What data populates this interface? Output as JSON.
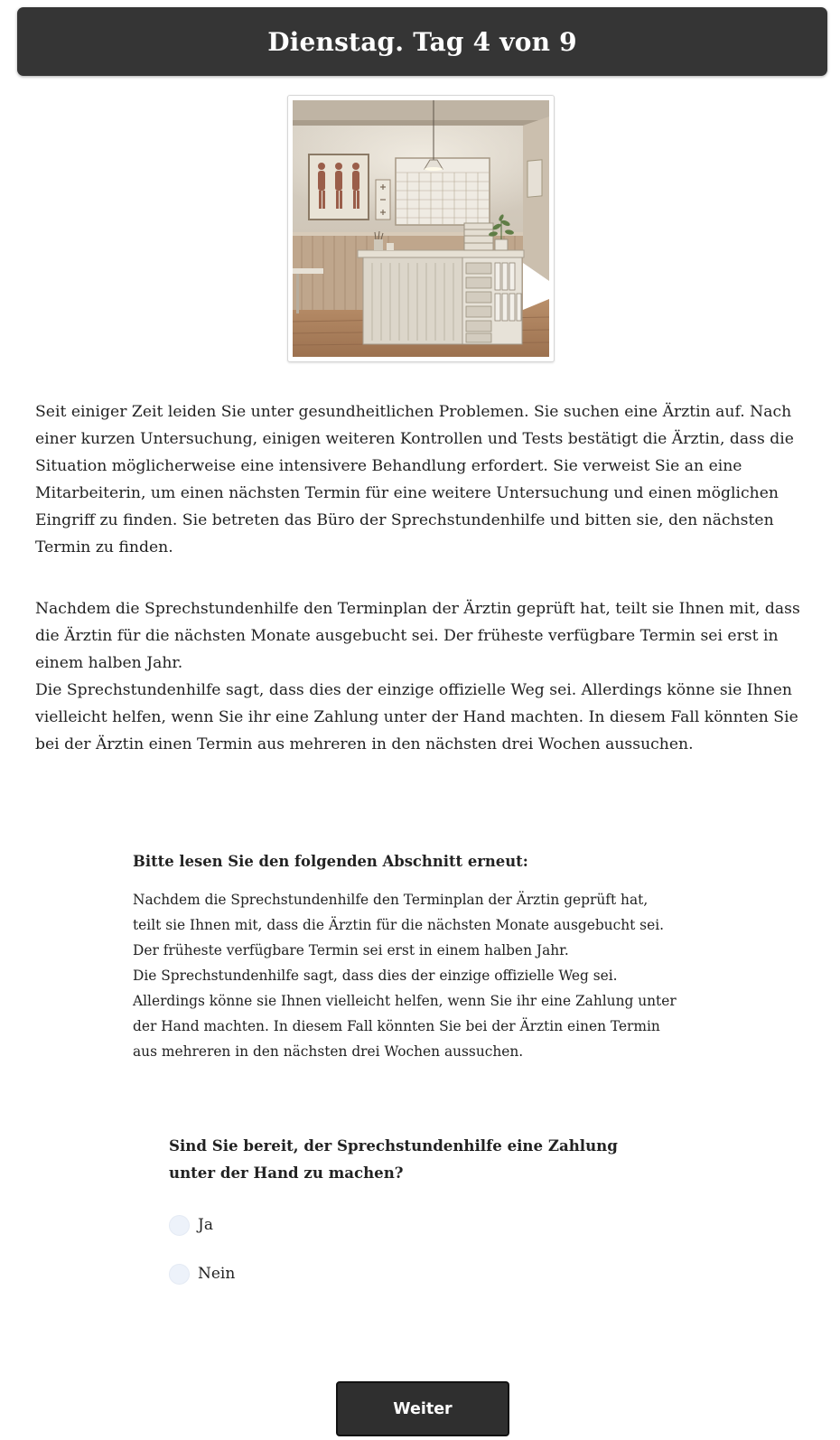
{
  "header": {
    "title": "Dienstag. Tag 4 von 9"
  },
  "illustration": {
    "icon": "office-reception-illustration"
  },
  "story": {
    "paragraph_1": "Seit einiger Zeit leiden Sie unter gesundheitlichen Problemen. Sie suchen eine Ärztin auf. Nach einer kurzen Untersuchung, einigen weiteren Kontrollen und Tests bestätigt die Ärztin, dass die Situation möglicherweise eine intensivere Behandlung erfordert. Sie verweist Sie an eine Mitarbeiterin, um einen nächsten Termin für eine weitere Untersuchung und einen möglichen Eingriff zu finden. Sie betreten das Büro der Sprechstundenhilfe und bitten sie, den nächsten Termin zu finden.",
    "paragraph_2": "Nachdem die Sprechstundenhilfe den Terminplan der Ärztin geprüft hat, teilt sie Ihnen mit, dass die Ärztin für die nächsten Monate ausgebucht sei. Der früheste verfügbare Termin sei erst in einem halben Jahr.",
    "paragraph_3": "Die Sprechstundenhilfe sagt, dass dies der einzige offizielle Weg sei. Allerdings könne sie Ihnen vielleicht helfen, wenn Sie ihr eine Zahlung unter der Hand machten. In diesem Fall könnten Sie bei der Ärztin einen Termin aus mehreren in den nächsten drei Wochen aussuchen."
  },
  "reread": {
    "title": "Bitte lesen Sie den folgenden Abschnitt erneut:",
    "lines": [
      "Nachdem die Sprechstundenhilfe den Terminplan der Ärztin geprüft hat,",
      "teilt sie Ihnen mit, dass die Ärztin für die nächsten Monate ausgebucht sei.",
      "Der früheste verfügbare Termin sei erst in einem halben Jahr.",
      "Die Sprechstundenhilfe sagt, dass dies der einzige offizielle Weg sei.",
      "Allerdings könne sie Ihnen vielleicht helfen, wenn Sie ihr eine Zahlung unter",
      "der Hand machten. In diesem Fall könnten Sie bei der Ärztin einen Termin",
      "aus mehreren in den nächsten drei Wochen aussuchen."
    ]
  },
  "question": {
    "text": "Sind Sie bereit, der Sprechstundenhilfe eine Zahlung unter der Hand zu machen?",
    "options": [
      {
        "label": "Ja",
        "selected": false
      },
      {
        "label": "Nein",
        "selected": false
      }
    ]
  },
  "actions": {
    "next_label": "Weiter"
  },
  "colors": {
    "header_bg": "#353535",
    "button_bg": "#2f2f2f",
    "radio_bg": "#edf2fa",
    "text": "#222222"
  }
}
